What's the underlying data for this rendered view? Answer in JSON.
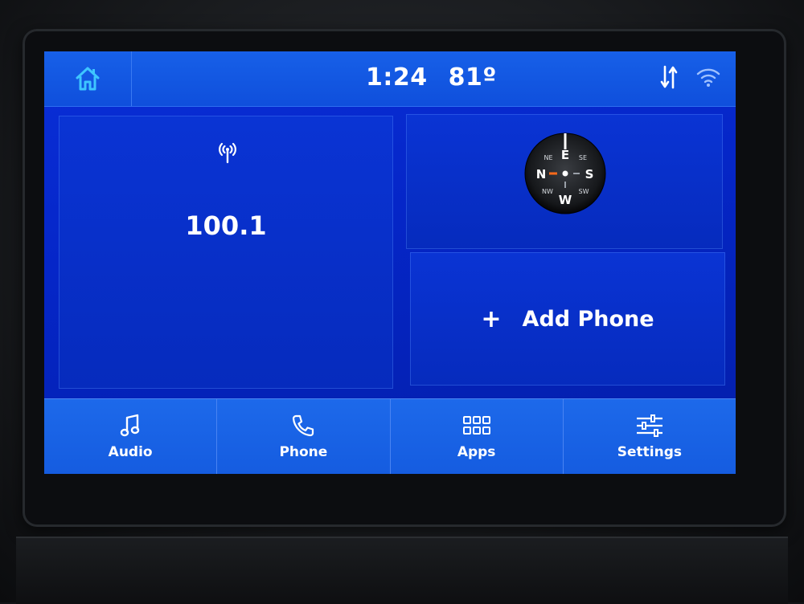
{
  "statusbar": {
    "time": "1:24",
    "temperature": "81º"
  },
  "radio": {
    "frequency": "100.1"
  },
  "compass": {
    "labels": {
      "n": "N",
      "e": "E",
      "s": "S",
      "w": "W",
      "ne": "NE",
      "se": "SE",
      "sw": "SW",
      "nw": "NW"
    }
  },
  "phone": {
    "plus": "+",
    "add_label": "Add Phone"
  },
  "nav": {
    "items": [
      {
        "label": "Audio",
        "icon": "music-note-icon"
      },
      {
        "label": "Phone",
        "icon": "phone-handset-icon"
      },
      {
        "label": "Apps",
        "icon": "apps-grid-icon"
      },
      {
        "label": "Settings",
        "icon": "sliders-icon"
      }
    ]
  },
  "colors": {
    "screen_blue": "#0526c8",
    "bar_blue": "#155ce0",
    "home_icon": "#3ec6ff"
  }
}
